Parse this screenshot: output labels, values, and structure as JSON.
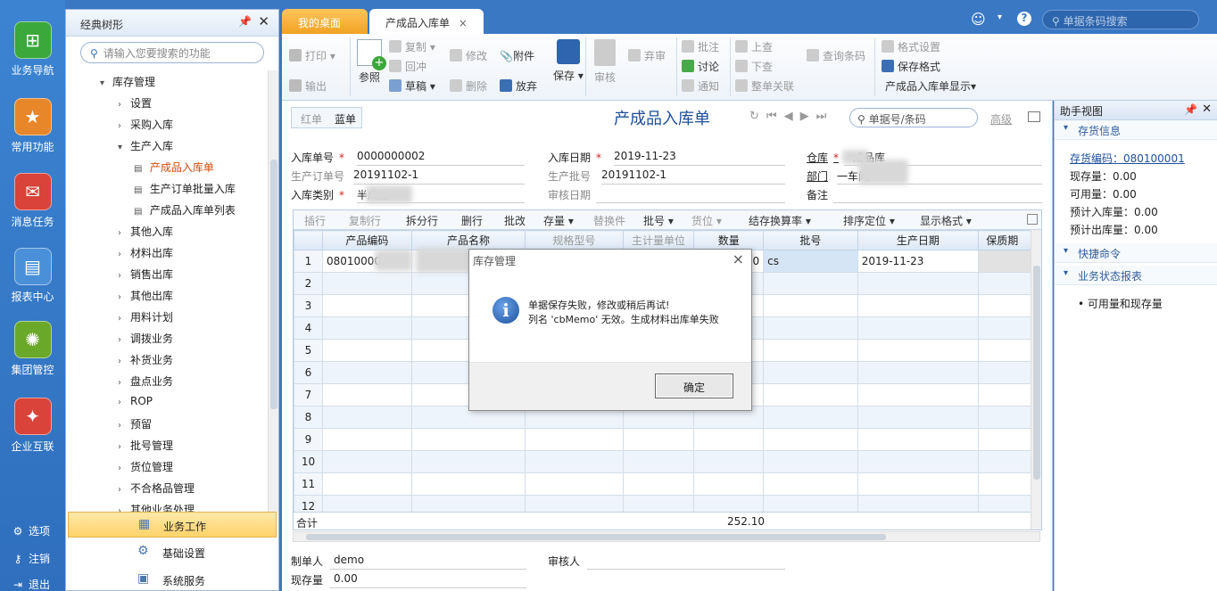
{
  "rail": {
    "items": [
      "业务导航",
      "常用功能",
      "消息任务",
      "报表中心",
      "集团管控",
      "企业互联"
    ],
    "bottom": [
      "选项",
      "注销",
      "退出"
    ]
  },
  "tree": {
    "title": "经典树形",
    "search_placeholder": "请输入您要搜索的功能",
    "nodes": [
      "库存管理",
      "设置",
      "采购入库",
      "生产入库",
      "产成品入库单",
      "生产订单批量入库",
      "产成品入库单列表",
      "其他入库",
      "材料出库",
      "销售出库",
      "其他出库",
      "用料计划",
      "调拨业务",
      "补货业务",
      "盘点业务",
      "ROP",
      "预留",
      "批号管理",
      "货位管理",
      "不合格品管理",
      "其他业务处理"
    ],
    "sections": [
      "业务工作",
      "基础设置",
      "系统服务"
    ]
  },
  "tabs": [
    "我的桌面",
    "产成品入库单"
  ],
  "global_search_placeholder": "单据条码搜索",
  "ribbon": {
    "print": "打印",
    "export": "输出",
    "ref": "参照",
    "copy": "复制",
    "chong": "回冲",
    "draft": "草稿",
    "modify": "修改",
    "delete": "删除",
    "attach": "附件",
    "discard": "放弃",
    "save": "保存",
    "audit": "审核",
    "abandon": "弃审",
    "approve_note": "批注",
    "discuss": "讨论",
    "notify": "通知",
    "prev": "上查",
    "next": "下查",
    "link": "整单关联",
    "barcode": "查询条码",
    "fmt_setting": "格式设置",
    "save_fmt": "保存格式",
    "display": "产成品入库单显示"
  },
  "doc": {
    "red": "红单",
    "blue": "蓝单",
    "title": "产成品入库单",
    "search_placeholder": "单据号/条码",
    "advanced": "高级",
    "fields": {
      "no_lbl": "入库单号",
      "no": "0000000002",
      "date_lbl": "入库日期",
      "date": "2019-11-23",
      "wh_lbl": "仓库",
      "wh": "成品库",
      "order_lbl": "生产订单号",
      "order": "20191102-1",
      "batch_lbl": "生产批号",
      "batch": "20191102-1",
      "dept_lbl": "部门",
      "dept": "一车间",
      "type_lbl": "入库类别",
      "type": "半成品",
      "audit_date_lbl": "审核日期",
      "remark_lbl": "备注"
    },
    "grid_tools": [
      "插行",
      "复制行",
      "拆分行",
      "删行",
      "批改",
      "存量",
      "替换件",
      "批号",
      "货位",
      "结存换算率",
      "排序定位",
      "显示格式"
    ],
    "columns": [
      "产品编码",
      "产品名称",
      "规格型号",
      "主计量单位",
      "数量",
      "批号",
      "生产日期",
      "保质期"
    ],
    "row1": {
      "code": "08010000",
      "qty": "252.10",
      "batch": "cs",
      "date": "2019-11-23"
    },
    "row_numbers": [
      "1",
      "2",
      "3",
      "4",
      "5",
      "6",
      "7",
      "8",
      "9",
      "10",
      "11",
      "12"
    ],
    "total_lbl": "合计",
    "total": "252.10",
    "maker_lbl": "制单人",
    "maker": "demo",
    "auditor_lbl": "审核人",
    "stock_lbl": "现存量",
    "stock": "0.00"
  },
  "helper": {
    "title": "助手视图",
    "sec1": "存货信息",
    "code": "存货编码：080100001",
    "lines": [
      "现存量：0.00",
      "可用量：0.00",
      "预计入库量：0.00",
      "预计出库量：0.00"
    ],
    "sec2": "快捷命令",
    "sec3": "业务状态报表",
    "item": "• 可用量和现存量"
  },
  "dialog": {
    "title": "库存管理",
    "line1": "单据保存失败，修改或稍后再试!",
    "line2": "列名 'cbMemo' 无效。生成材料出库单失败",
    "ok": "确定"
  }
}
